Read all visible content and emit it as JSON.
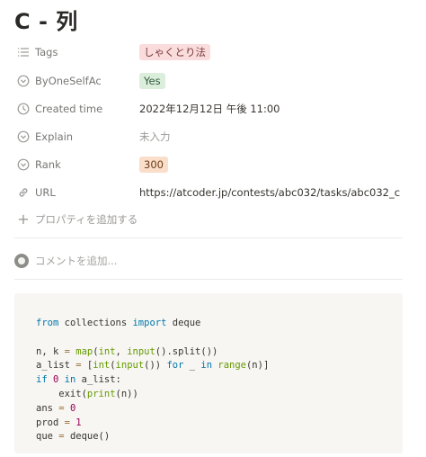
{
  "title": "C - 列",
  "properties": [
    {
      "icon": "list-icon",
      "label": "Tags",
      "value": "しゃくとり法",
      "style": "tag",
      "color": "#fbdcdd"
    },
    {
      "icon": "select-icon",
      "label": "ByOneSelfAc",
      "value": "Yes",
      "style": "tag",
      "color": "#dbeddb"
    },
    {
      "icon": "clock-icon",
      "label": "Created time",
      "value": "2022年12月12日 午後 11:00",
      "style": "text"
    },
    {
      "icon": "select-icon",
      "label": "Explain",
      "value": "未入力",
      "style": "empty"
    },
    {
      "icon": "select-icon",
      "label": "Rank",
      "value": "300",
      "style": "tag",
      "color": "#fadec9"
    },
    {
      "icon": "link-icon",
      "label": "URL",
      "value": "https://atcoder.jp/contests/abc032/tasks/abc032_c",
      "style": "text"
    }
  ],
  "add_property_label": "プロパティを追加する",
  "comment_placeholder": "コメントを追加...",
  "code_lines": [
    "from collections import deque",
    "",
    "n, k = map(int, input().split())",
    "a_list = [int(input()) for _ in range(n)]",
    "if 0 in a_list:",
    "    exit(print(n))",
    "ans = 0",
    "prod = 1",
    "que = deque()"
  ]
}
